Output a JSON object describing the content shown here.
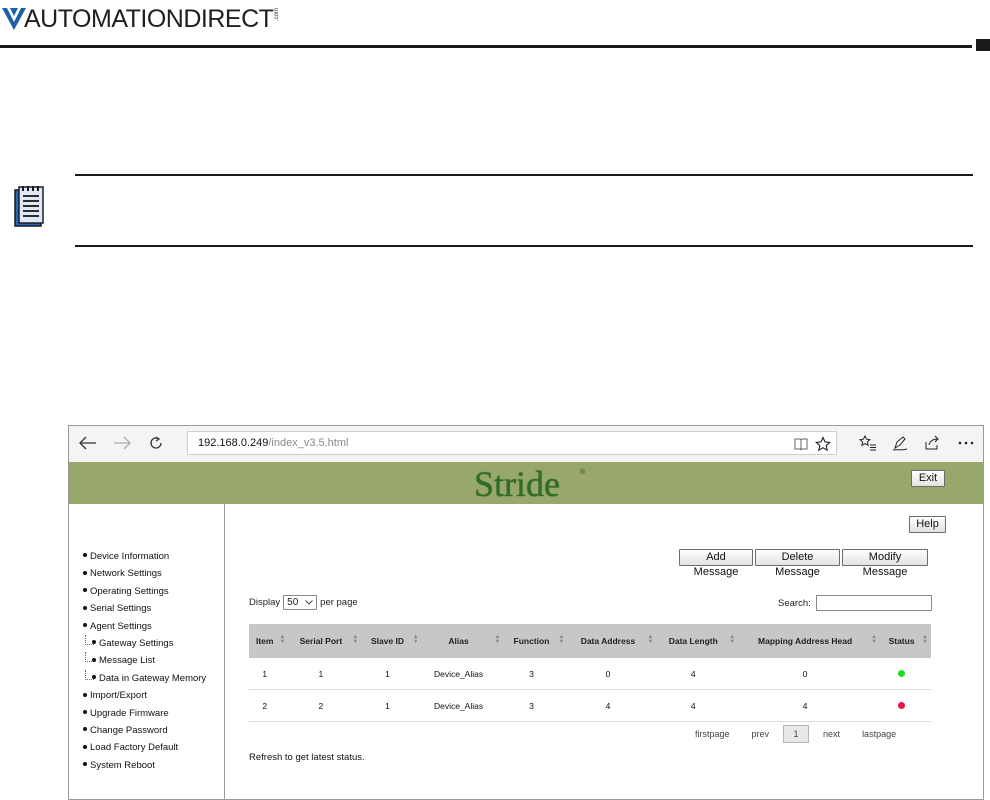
{
  "document": {
    "brand": "AUTOMATIONDIRECT",
    "brand_suffix": ".com"
  },
  "browser": {
    "address_host": "192.168.0.249",
    "address_path": "/index_v3.5.html"
  },
  "app": {
    "logo_text": "Stride",
    "logo_mark": "®",
    "exit_label": "Exit",
    "help_label": "Help",
    "accent_color": "#97a86a",
    "logo_color": "#2f6b2a"
  },
  "sidebar": {
    "items": [
      {
        "label": "Device Information",
        "level": 0
      },
      {
        "label": "Network Settings",
        "level": 0
      },
      {
        "label": "Operating Settings",
        "level": 0
      },
      {
        "label": "Serial Settings",
        "level": 0
      },
      {
        "label": "Agent Settings",
        "level": 0
      },
      {
        "label": "Gateway Settings",
        "level": 1
      },
      {
        "label": "Message List",
        "level": 1
      },
      {
        "label": "Data in Gateway Memory",
        "level": 1
      },
      {
        "label": "Import/Export",
        "level": 0
      },
      {
        "label": "Upgrade Firmware",
        "level": 0
      },
      {
        "label": "Change Password",
        "level": 0
      },
      {
        "label": "Load Factory Default",
        "level": 0
      },
      {
        "label": "System Reboot",
        "level": 0
      }
    ]
  },
  "actions": {
    "add": "Add Message",
    "delete": "Delete Message",
    "modify": "Modify Message"
  },
  "list_controls": {
    "display_label": "Display",
    "per_page_value": "50",
    "per_page_label": "per page",
    "search_label": "Search:",
    "search_value": ""
  },
  "table": {
    "columns": [
      "Item",
      "Serial Port",
      "Slave ID",
      "Alias",
      "Function",
      "Data Address",
      "Data Length",
      "Mapping Address Head",
      "Status"
    ],
    "rows": [
      {
        "item": "1",
        "serial_port": "1",
        "slave_id": "1",
        "alias": "Device_Alias",
        "function": "3",
        "data_address": "0",
        "data_length": "4",
        "mapping_address_head": "0",
        "status_color": "#22dd22"
      },
      {
        "item": "2",
        "serial_port": "2",
        "slave_id": "1",
        "alias": "Device_Alias",
        "function": "3",
        "data_address": "4",
        "data_length": "4",
        "mapping_address_head": "4",
        "status_color": "#ee1144"
      }
    ]
  },
  "pager": {
    "first": "firstpage",
    "prev": "prev",
    "current": "1",
    "next": "next",
    "last": "lastpage"
  },
  "footer_note": "Refresh to get latest status."
}
